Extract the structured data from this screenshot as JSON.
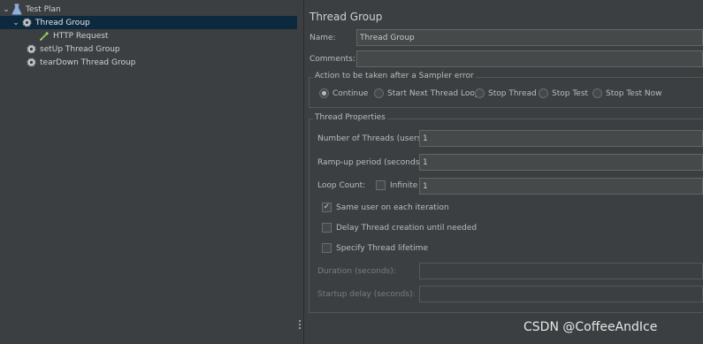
{
  "tree": {
    "items": [
      {
        "label": "Test Plan",
        "icon": "flask-icon",
        "expanded": true
      },
      {
        "label": "Thread Group",
        "icon": "gear-icon",
        "expanded": true,
        "selected": true
      },
      {
        "label": "HTTP Request",
        "icon": "pipette-icon"
      },
      {
        "label": "setUp Thread Group",
        "icon": "gear-icon"
      },
      {
        "label": "tearDown Thread Group",
        "icon": "gear-icon"
      }
    ]
  },
  "panel": {
    "title": "Thread Group",
    "name_label": "Name:",
    "name_value": "Thread Group",
    "comments_label": "Comments:",
    "comments_value": "",
    "sampler_error": {
      "title": "Action to be taken after a Sampler error",
      "options": [
        "Continue",
        "Start Next Thread Loop",
        "Stop Thread",
        "Stop Test",
        "Stop Test Now"
      ],
      "selected": "Continue"
    },
    "thread_properties": {
      "title": "Thread Properties",
      "num_threads_label": "Number of Threads (users):",
      "num_threads_value": "1",
      "rampup_label": "Ramp-up period (seconds):",
      "rampup_value": "1",
      "loop_label": "Loop Count:",
      "infinite_label": "Infinite",
      "infinite_checked": false,
      "loop_value": "1",
      "same_user_label": "Same user on each iteration",
      "same_user_checked": true,
      "delay_label": "Delay Thread creation until needed",
      "delay_checked": false,
      "lifetime_label": "Specify Thread lifetime",
      "lifetime_checked": false,
      "duration_label": "Duration (seconds):",
      "duration_value": "",
      "startup_label": "Startup delay (seconds):",
      "startup_value": ""
    }
  },
  "watermark": "CSDN @CoffeeAndIce"
}
